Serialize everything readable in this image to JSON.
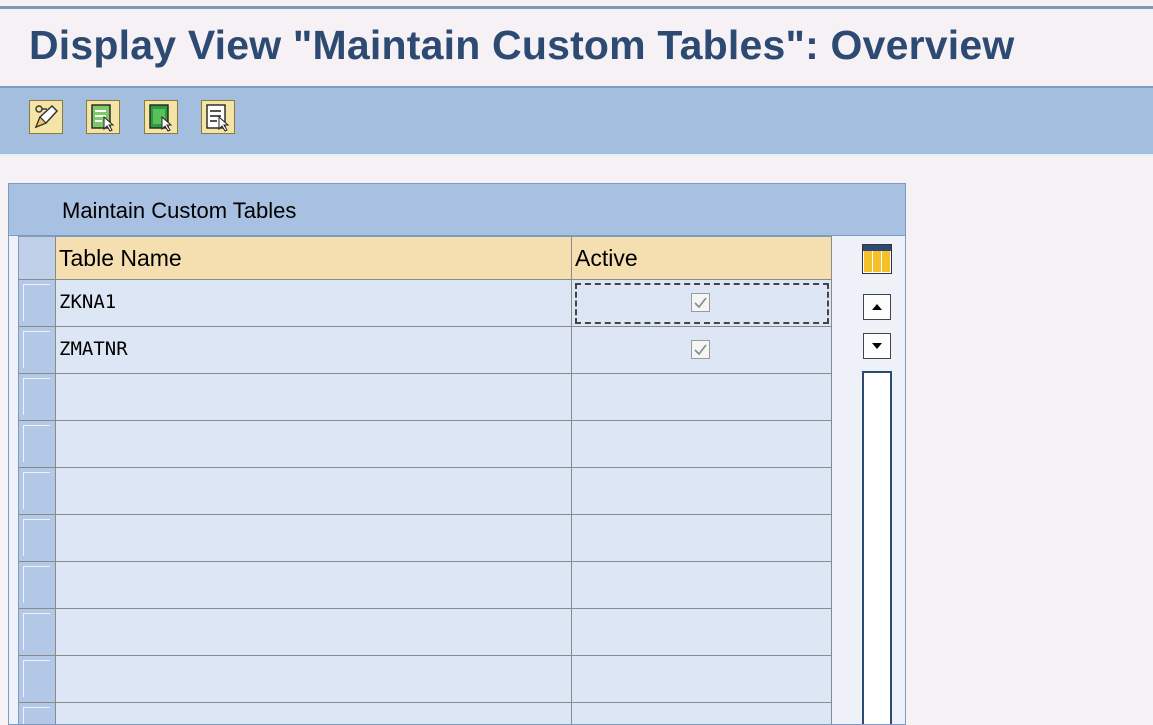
{
  "page": {
    "title": "Display View \"Maintain Custom Tables\": Overview"
  },
  "toolbar": {
    "buttons": [
      {
        "icon": "display-change-icon"
      },
      {
        "icon": "select-all-icon"
      },
      {
        "icon": "select-block-icon"
      },
      {
        "icon": "deselect-all-icon"
      }
    ]
  },
  "table": {
    "title": "Maintain Custom Tables",
    "columns": [
      "Table Name",
      "Active"
    ],
    "rows": [
      {
        "name": "ZKNA1",
        "active": true
      },
      {
        "name": "ZMATNR",
        "active": true
      },
      {
        "name": "",
        "active": false
      },
      {
        "name": "",
        "active": false
      },
      {
        "name": "",
        "active": false
      },
      {
        "name": "",
        "active": false
      },
      {
        "name": "",
        "active": false
      },
      {
        "name": "",
        "active": false
      },
      {
        "name": "",
        "active": false
      },
      {
        "name": "",
        "active": false
      }
    ]
  },
  "colors": {
    "title": "#2c4a72",
    "toolbar": "#a4bedf",
    "panel_header": "#a8c0e2",
    "column_header": "#f5deb0",
    "cell": "#dde6f5"
  }
}
